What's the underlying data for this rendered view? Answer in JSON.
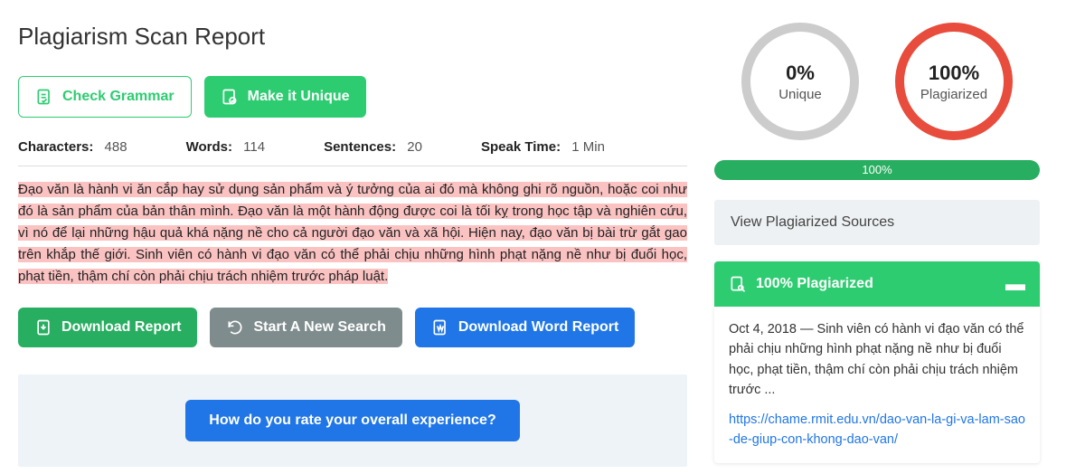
{
  "title": "Plagiarism Scan Report",
  "buttons": {
    "check_grammar": "Check Grammar",
    "make_unique": "Make it Unique",
    "download_report": "Download Report",
    "new_search": "Start A New Search",
    "download_word": "Download Word Report"
  },
  "stats": {
    "characters_label": "Characters:",
    "characters_value": "488",
    "words_label": "Words:",
    "words_value": "114",
    "sentences_label": "Sentences:",
    "sentences_value": "20",
    "speak_label": "Speak Time:",
    "speak_value": "1 Min"
  },
  "scanned_text": " Đạo văn là hành vi ăn cắp hay sử dụng sản phẩm và ý tưởng của ai đó mà không ghi rõ nguồn, hoặc coi như đó là sản phẩm  của bản thân mình.  Đạo văn là một hành động được coi là tối kỵ trong học tập và nghiên cứu, vì nó để lại những hậu quả khá nặng nề cho cả  người đạo văn và xã hội.  Hiện nay, đạo văn bị bài trừ gắt gao trên khắp thế giới.   Sinh viên có hành vi đạo văn có thể phải chịu những hình phạt nặng nề như bị đuổi học, phạt tiền, thậm chí còn phải chịu trách nhiệm  trước pháp luật.",
  "rating_question": "How do you rate your overall experience?",
  "circles": {
    "unique_pct": "0%",
    "unique_label": "Unique",
    "plag_pct": "100%",
    "plag_label": "Plagiarized"
  },
  "progress_text": "100%",
  "sources_header": "View Plagiarized Sources",
  "source": {
    "badge": "100% Plagiarized",
    "snippet": "Oct 4, 2018 — Sinh viên có hành vi đạo văn có thể phải chịu những hình phạt nặng nề như bị đuổi học, phạt tiền, thậm chí còn phải chịu trách nhiệm trước ...",
    "url": "https://chame.rmit.edu.vn/dao-van-la-gi-va-lam-sao-de-giup-con-khong-dao-van/"
  }
}
